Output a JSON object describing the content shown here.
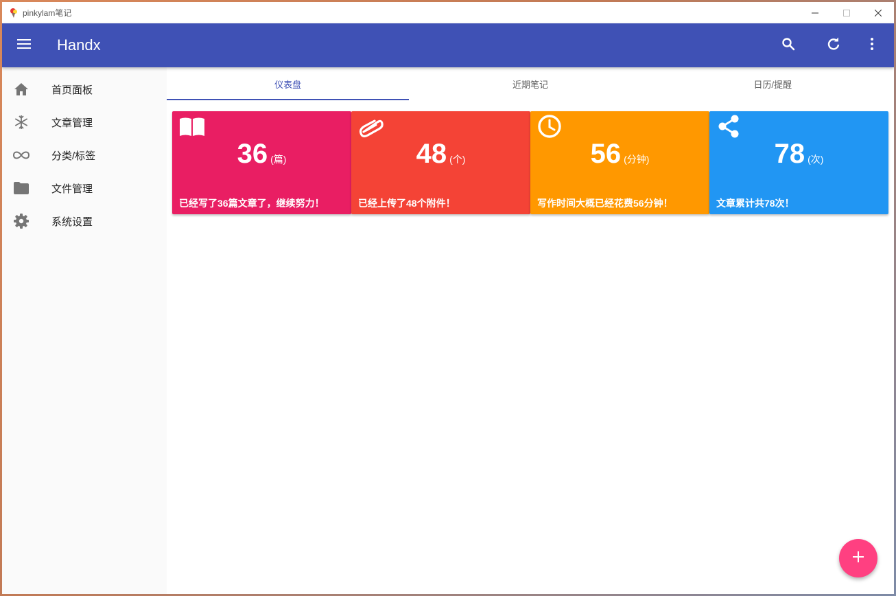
{
  "window": {
    "title": "pinkylam笔记",
    "controls": {
      "minimize": "—",
      "maximize": "☐",
      "close": "✕"
    }
  },
  "appbar": {
    "title": "Handx",
    "icons": [
      "menu-icon",
      "search-icon",
      "refresh-icon",
      "more-vert-icon"
    ]
  },
  "sidebar": {
    "items": [
      {
        "label": "首页面板",
        "icon": "home-icon"
      },
      {
        "label": "文章管理",
        "icon": "snowflake-icon"
      },
      {
        "label": "分类/标签",
        "icon": "infinity-icon"
      },
      {
        "label": "文件管理",
        "icon": "folder-icon"
      },
      {
        "label": "系统设置",
        "icon": "gear-icon"
      }
    ]
  },
  "tabs": [
    {
      "label": "仪表盘",
      "active": true
    },
    {
      "label": "近期笔记",
      "active": false
    },
    {
      "label": "日历/提醒",
      "active": false
    }
  ],
  "cards": [
    {
      "number": "36",
      "unit": "(篇)",
      "desc": "已经写了36篇文章了，继续努力！",
      "color": "#e91e63",
      "icon": "book-icon"
    },
    {
      "number": "48",
      "unit": "(个)",
      "desc": "已经上传了48个附件！",
      "color": "#f44336",
      "icon": "paperclip-icon"
    },
    {
      "number": "56",
      "unit": "(分钟)",
      "desc": "写作时间大概已经花费56分钟！",
      "color": "#ff9800",
      "icon": "clock-icon"
    },
    {
      "number": "78",
      "unit": "(次)",
      "desc": "文章累计共78次！",
      "color": "#2196f3",
      "icon": "share-icon"
    }
  ],
  "fab": {
    "label": "+",
    "icon": "plus-icon",
    "color": "#ff4081"
  },
  "colors": {
    "primary": "#3f51b5",
    "accent": "#ff4081"
  }
}
